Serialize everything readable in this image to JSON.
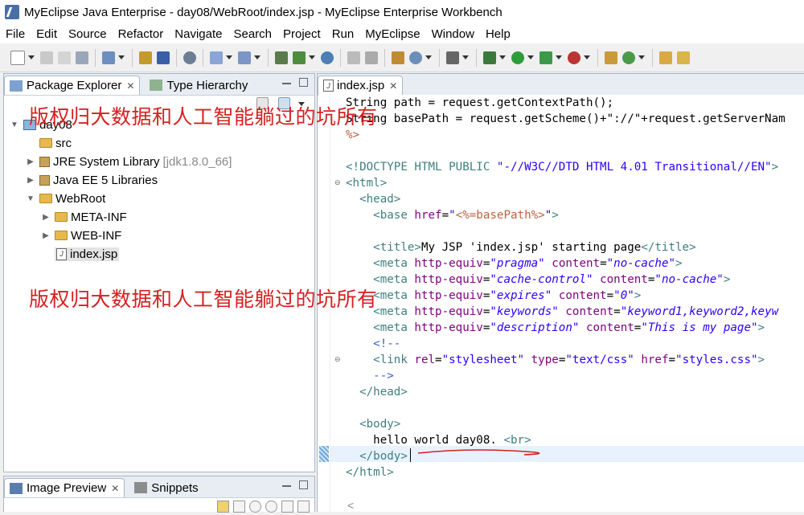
{
  "window": {
    "title": "MyEclipse Java Enterprise - day08/WebRoot/index.jsp - MyEclipse Enterprise Workbench"
  },
  "menu": [
    "File",
    "Edit",
    "Source",
    "Refactor",
    "Navigate",
    "Search",
    "Project",
    "Run",
    "MyEclipse",
    "Window",
    "Help"
  ],
  "left_panel": {
    "tabs": [
      {
        "label": "Package Explorer",
        "icon": "package-explorer-icon"
      },
      {
        "label": "Type Hierarchy",
        "icon": "type-hierarchy-icon"
      }
    ],
    "tree": [
      {
        "label": "day08",
        "icon": "project-icon",
        "expanded": true
      },
      {
        "label": "src",
        "icon": "source-folder-icon"
      },
      {
        "label": "JRE System Library",
        "suffix": "[jdk1.8.0_66]",
        "icon": "library-icon"
      },
      {
        "label": "Java EE 5 Libraries",
        "icon": "library-icon"
      },
      {
        "label": "WebRoot",
        "icon": "folder-icon",
        "expanded": true
      },
      {
        "label": "META-INF",
        "icon": "folder-icon"
      },
      {
        "label": "WEB-INF",
        "icon": "folder-icon"
      },
      {
        "label": "index.jsp",
        "icon": "jsp-file-icon",
        "selected": true
      }
    ]
  },
  "bottom_panel": {
    "tabs": [
      {
        "label": "Image Preview",
        "icon": "image-preview-icon"
      },
      {
        "label": "Snippets",
        "icon": "snippets-icon"
      }
    ]
  },
  "editor": {
    "tab": {
      "label": "index.jsp",
      "icon": "jsp-file-icon"
    },
    "lines": [
      [
        [
          "plain",
          "String path = request.getContextPath();"
        ]
      ],
      [
        [
          "plain",
          "String basePath = request.getScheme()+\"://\"+request.getServerNam"
        ]
      ],
      [
        [
          "jsp",
          "%>"
        ]
      ],
      [
        [
          "plain",
          ""
        ]
      ],
      [
        [
          "tag",
          "<!DOCTYPE HTML PUBLIC "
        ],
        [
          "valn",
          "\"-//W3C//DTD HTML 4.01 Transitional//EN\""
        ],
        [
          "tag",
          ">"
        ]
      ],
      [
        [
          "tag",
          "<html>"
        ]
      ],
      [
        [
          "plain",
          "  "
        ],
        [
          "tag",
          "<head>"
        ]
      ],
      [
        [
          "plain",
          "    "
        ],
        [
          "tag",
          "<base "
        ],
        [
          "attr",
          "href"
        ],
        [
          "plain",
          "="
        ],
        [
          "valn",
          "\""
        ],
        [
          "jsp",
          "<%=basePath%>"
        ],
        [
          "valn",
          "\""
        ],
        [
          "tag",
          ">"
        ]
      ],
      [
        [
          "plain",
          ""
        ]
      ],
      [
        [
          "plain",
          "    "
        ],
        [
          "tag",
          "<title>"
        ],
        [
          "plain",
          "My JSP 'index.jsp' starting page"
        ],
        [
          "tag",
          "</title>"
        ]
      ],
      [
        [
          "plain",
          "    "
        ],
        [
          "tag",
          "<meta "
        ],
        [
          "attr",
          "http-equiv"
        ],
        [
          "plain",
          "="
        ],
        [
          "val",
          "\"pragma\""
        ],
        [
          "plain",
          " "
        ],
        [
          "attr",
          "content"
        ],
        [
          "plain",
          "="
        ],
        [
          "val",
          "\"no-cache\""
        ],
        [
          "tag",
          ">"
        ]
      ],
      [
        [
          "plain",
          "    "
        ],
        [
          "tag",
          "<meta "
        ],
        [
          "attr",
          "http-equiv"
        ],
        [
          "plain",
          "="
        ],
        [
          "val",
          "\"cache-control\""
        ],
        [
          "plain",
          " "
        ],
        [
          "attr",
          "content"
        ],
        [
          "plain",
          "="
        ],
        [
          "val",
          "\"no-cache\""
        ],
        [
          "tag",
          ">"
        ]
      ],
      [
        [
          "plain",
          "    "
        ],
        [
          "tag",
          "<meta "
        ],
        [
          "attr",
          "http-equiv"
        ],
        [
          "plain",
          "="
        ],
        [
          "val",
          "\"expires\""
        ],
        [
          "plain",
          " "
        ],
        [
          "attr",
          "content"
        ],
        [
          "plain",
          "="
        ],
        [
          "val",
          "\"0\""
        ],
        [
          "tag",
          ">"
        ]
      ],
      [
        [
          "plain",
          "    "
        ],
        [
          "tag",
          "<meta "
        ],
        [
          "attr",
          "http-equiv"
        ],
        [
          "plain",
          "="
        ],
        [
          "val",
          "\"keywords\""
        ],
        [
          "plain",
          " "
        ],
        [
          "attr",
          "content"
        ],
        [
          "plain",
          "="
        ],
        [
          "val",
          "\"keyword1,keyword2,keyw"
        ]
      ],
      [
        [
          "plain",
          "    "
        ],
        [
          "tag",
          "<meta "
        ],
        [
          "attr",
          "http-equiv"
        ],
        [
          "plain",
          "="
        ],
        [
          "val",
          "\"description\""
        ],
        [
          "plain",
          " "
        ],
        [
          "attr",
          "content"
        ],
        [
          "plain",
          "="
        ],
        [
          "val",
          "\"This is my page\""
        ],
        [
          "tag",
          ">"
        ]
      ],
      [
        [
          "plain",
          "    "
        ],
        [
          "cmt",
          "<!--"
        ]
      ],
      [
        [
          "plain",
          "    "
        ],
        [
          "tag",
          "<link "
        ],
        [
          "attr",
          "rel"
        ],
        [
          "plain",
          "="
        ],
        [
          "valn",
          "\"stylesheet\""
        ],
        [
          "plain",
          " "
        ],
        [
          "attr",
          "type"
        ],
        [
          "plain",
          "="
        ],
        [
          "valn",
          "\"text/css\""
        ],
        [
          "plain",
          " "
        ],
        [
          "attr",
          "href"
        ],
        [
          "plain",
          "="
        ],
        [
          "valn",
          "\"styles.css\""
        ],
        [
          "tag",
          ">"
        ]
      ],
      [
        [
          "plain",
          "    "
        ],
        [
          "cmt",
          "-->"
        ]
      ],
      [
        [
          "plain",
          "  "
        ],
        [
          "tag",
          "</head>"
        ]
      ],
      [
        [
          "plain",
          ""
        ]
      ],
      [
        [
          "plain",
          "  "
        ],
        [
          "tag",
          "<body>"
        ]
      ],
      [
        [
          "plain",
          "    hello world day08. "
        ],
        [
          "tag",
          "<br>"
        ]
      ],
      [
        [
          "plain",
          "  "
        ],
        [
          "tag",
          "</body>"
        ]
      ],
      [
        [
          "tag",
          "</html>"
        ]
      ]
    ]
  },
  "watermark": "版权归大数据和人工智能躺过的坑所有",
  "colors": {
    "watermark": "#d62020",
    "tag": "#3f7f7f",
    "attribute": "#7f007f",
    "value": "#2a00ff",
    "jsp": "#bf5f3f",
    "comment": "#3f5fbf",
    "panel_border": "#a9b7c6"
  }
}
